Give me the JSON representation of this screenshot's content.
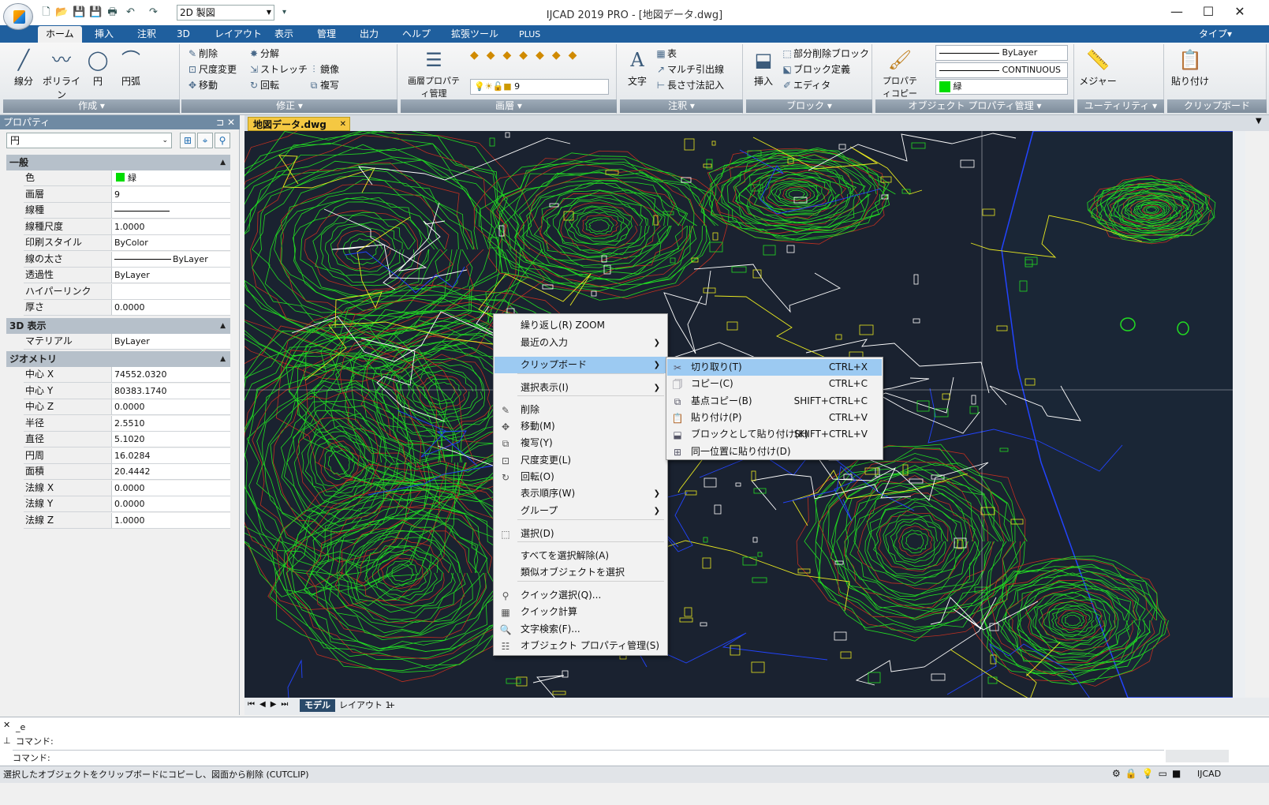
{
  "app": {
    "title": "IJCAD 2019 PRO - [地図データ.dwg]",
    "workspace": "2D 製図"
  },
  "menu_tabs": [
    "ホーム",
    "挿入",
    "注釈",
    "3D",
    "レイアウト",
    "表示",
    "管理",
    "出力",
    "ヘルプ",
    "拡張ツール",
    "PLUS"
  ],
  "menu_right": "タイプ▾",
  "ribbon": {
    "draw": {
      "label": "作成",
      "line": "線分",
      "polyline": "ポリライン",
      "circle": "円",
      "arc": "円弧"
    },
    "modify": {
      "label": "修正",
      "erase": "削除",
      "explode": "分解",
      "scale": "尺度変更",
      "stretch": "ストレッチ",
      "move": "移動",
      "rotate": "回転",
      "mirror": "鏡像",
      "copy": "複写"
    },
    "layer": {
      "label": "画層",
      "props": "画層プロパティ管理",
      "current": "9"
    },
    "annotation": {
      "label": "注釈",
      "text": "文字",
      "table": "表",
      "mleader": "マルチ引出線",
      "dim": "長さ寸法記入"
    },
    "block": {
      "label": "ブロック",
      "insert": "挿入",
      "partial": "部分削除ブロック",
      "define": "ブロック定義",
      "editor": "エディタ"
    },
    "objprops": {
      "label": "オブジェクト プロパティ管理",
      "copy": "プロパティコピー",
      "linetype_top": "ByLayer",
      "linetype": "CONTINUOUS",
      "color": "緑"
    },
    "utility": {
      "label": "ユーティリティ",
      "measure": "メジャー"
    },
    "clipboard": {
      "label": "クリップボード",
      "paste": "貼り付け"
    }
  },
  "doc_tab": "地図データ.dwg",
  "properties": {
    "title": "プロパティ",
    "object": "円",
    "general": {
      "header": "一般",
      "rows": [
        {
          "k": "色",
          "v": "緑"
        },
        {
          "k": "画層",
          "v": "9"
        },
        {
          "k": "線種",
          "v": "CONTINUOUS"
        },
        {
          "k": "線種尺度",
          "v": "1.0000"
        },
        {
          "k": "印刷スタイル",
          "v": "ByColor"
        },
        {
          "k": "線の太さ",
          "v": "ByLayer"
        },
        {
          "k": "透過性",
          "v": "ByLayer"
        },
        {
          "k": "ハイパーリンク",
          "v": ""
        },
        {
          "k": "厚さ",
          "v": "0.0000"
        }
      ]
    },
    "view3d": {
      "header": "3D 表示",
      "rows": [
        {
          "k": "マテリアル",
          "v": "ByLayer"
        }
      ]
    },
    "geometry": {
      "header": "ジオメトリ",
      "rows": [
        {
          "k": "中心 X",
          "v": "74552.0320"
        },
        {
          "k": "中心 Y",
          "v": "80383.1740"
        },
        {
          "k": "中心 Z",
          "v": "0.0000"
        },
        {
          "k": "半径",
          "v": "2.5510"
        },
        {
          "k": "直径",
          "v": "5.1020"
        },
        {
          "k": "円周",
          "v": "16.0284"
        },
        {
          "k": "面積",
          "v": "20.4442"
        },
        {
          "k": "法線 X",
          "v": "0.0000"
        },
        {
          "k": "法線 Y",
          "v": "0.0000"
        },
        {
          "k": "法線 Z",
          "v": "1.0000"
        }
      ]
    }
  },
  "layout_tabs": {
    "model": "モデル",
    "layout1": "レイアウト 1",
    "plus": "+"
  },
  "command": {
    "lines": [
      "_e",
      "コマンド:",
      "コマンド:"
    ]
  },
  "status_text": "選択したオブジェクトをクリップボードにコピーし、図面から削除 (CUTCLIP)",
  "status_right": "IJCAD",
  "context_menu": {
    "items": [
      {
        "label": "繰り返し(R) ZOOM",
        "icon": "none"
      },
      {
        "label": "最近の入力",
        "icon": "none",
        "sub": true
      },
      {
        "label": "クリップボード",
        "icon": "none",
        "sub": true,
        "hl": true
      },
      {
        "label": "選択表示(I)",
        "icon": "none",
        "sub": true
      },
      {
        "label": "削除",
        "icon": "eraser-icon"
      },
      {
        "label": "移動(M)",
        "icon": "move-icon"
      },
      {
        "label": "複写(Y)",
        "icon": "copy-icon"
      },
      {
        "label": "尺度変更(L)",
        "icon": "scale-icon"
      },
      {
        "label": "回転(O)",
        "icon": "rotate-icon"
      },
      {
        "label": "表示順序(W)",
        "icon": "none",
        "sub": true
      },
      {
        "label": "グループ",
        "icon": "none",
        "sub": true
      },
      {
        "label": "選択(D)",
        "icon": "select-icon"
      },
      {
        "label": "すべてを選択解除(A)",
        "icon": "none"
      },
      {
        "label": "類似オブジェクトを選択",
        "icon": "none"
      },
      {
        "label": "クイック選択(Q)...",
        "icon": "quick-select-icon"
      },
      {
        "label": "クイック計算",
        "icon": "calculator-icon"
      },
      {
        "label": "文字検索(F)...",
        "icon": "find-icon"
      },
      {
        "label": "オブジェクト プロパティ管理(S)",
        "icon": "properties-icon"
      }
    ]
  },
  "submenu": {
    "items": [
      {
        "label": "切り取り(T)",
        "shortcut": "CTRL+X",
        "icon": "cut-icon",
        "hl": true
      },
      {
        "label": "コピー(C)",
        "shortcut": "CTRL+C",
        "icon": "copy-doc-icon"
      },
      {
        "label": "基点コピー(B)",
        "shortcut": "SHIFT+CTRL+C",
        "icon": "base-copy-icon"
      },
      {
        "label": "貼り付け(P)",
        "shortcut": "CTRL+V",
        "icon": "paste-icon"
      },
      {
        "label": "ブロックとして貼り付け(K)",
        "shortcut": "SHIFT+CTRL+V",
        "icon": "paste-block-icon"
      },
      {
        "label": "同一位置に貼り付け(D)",
        "shortcut": "",
        "icon": "paste-orig-icon"
      }
    ]
  },
  "colors": {
    "menubar": "#1f5f9e",
    "canvas": "#1a2230",
    "contour": "#22dd22",
    "highlight": "#9ccaf2",
    "doc_tab": "#f5c842"
  }
}
